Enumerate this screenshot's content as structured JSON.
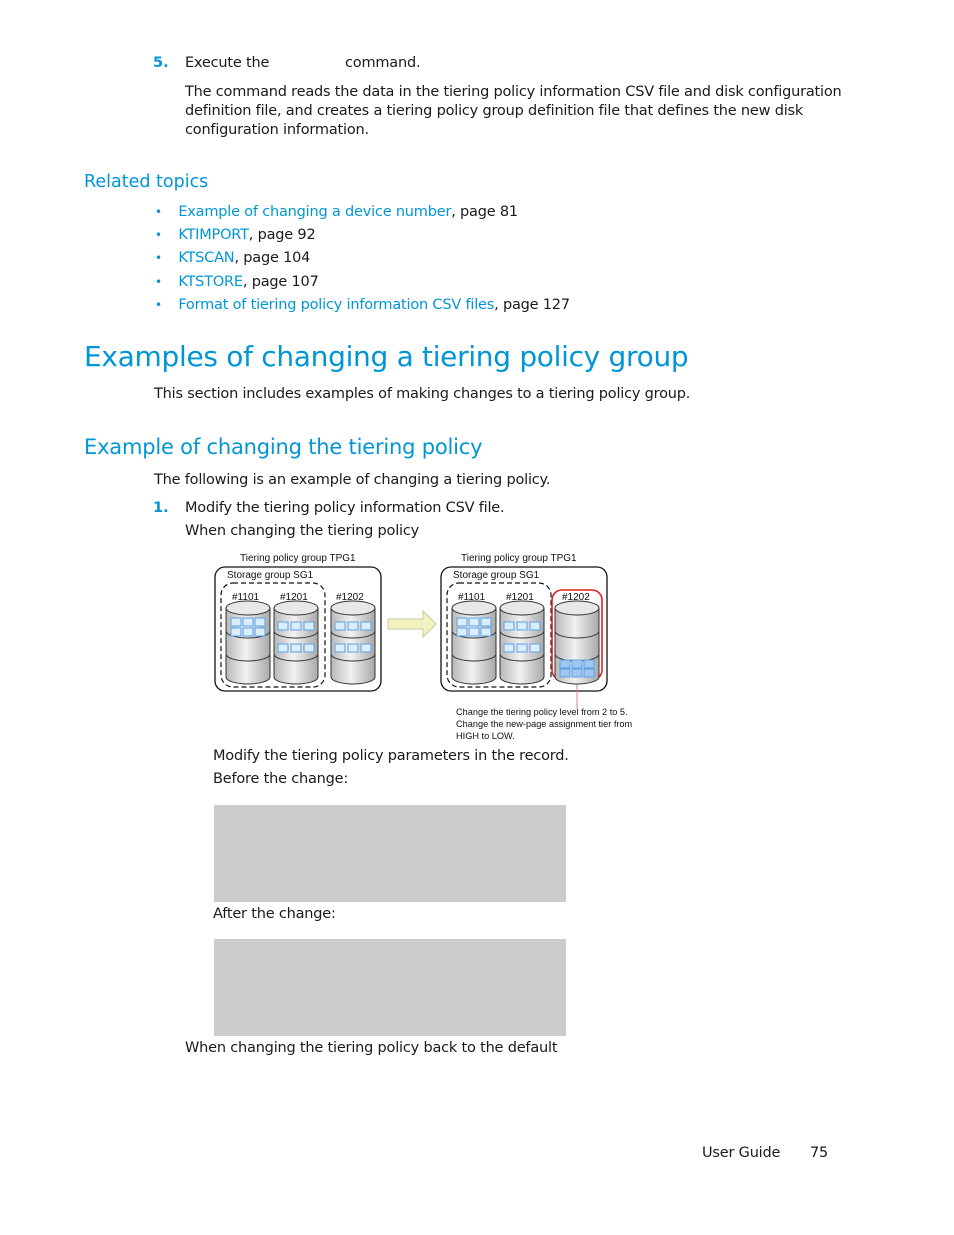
{
  "step5": {
    "number": "5.",
    "text_before": "Execute the",
    "text_after": "command.",
    "description_lines": [
      "The command reads the data in the tiering policy information CSV file and disk configuration",
      "definition file, and creates a tiering policy group definition file that defines the new disk",
      "configuration information."
    ]
  },
  "related_topics": {
    "heading": "Related topics",
    "items": [
      {
        "link": "Example of changing a device number",
        "suffix": ", page 81"
      },
      {
        "link": "KTIMPORT",
        "suffix": ", page 92"
      },
      {
        "link": "KTSCAN",
        "suffix": ", page 104"
      },
      {
        "link": "KTSTORE",
        "suffix": ", page 107"
      },
      {
        "link": "Format of tiering policy information CSV files",
        "suffix": ", page 127"
      }
    ]
  },
  "section": {
    "title": "Examples of changing a tiering policy group",
    "intro": "This section includes examples of making changes to a tiering policy group."
  },
  "subsection": {
    "title": "Example of changing the tiering policy",
    "intro": "The following is an example of changing a tiering policy.",
    "step1_number": "1.",
    "step1_text": "Modify the tiering policy information CSV file.",
    "case1_label": "When changing the tiering policy",
    "modify_text": "Modify the tiering policy parameters in the record.",
    "before_label": "Before the change:",
    "after_label": "After the change:",
    "case2_label": "When changing the tiering policy back to the default"
  },
  "diagram": {
    "before": {
      "group_label": "Tiering policy group TPG1",
      "storage_label": "Storage group SG1",
      "volumes": [
        "#1101",
        "#1201",
        "#1202"
      ]
    },
    "after": {
      "group_label": "Tiering policy group TPG1",
      "storage_label": "Storage group SG1",
      "volumes": [
        "#1101",
        "#1201",
        "#1202"
      ]
    },
    "annotation_lines": [
      "Change the tiering policy level from 2 to 5.",
      "Change the new-page assignment tier from",
      "HIGH to LOW."
    ],
    "colors": {
      "link_blue": "#0096d6",
      "page_block_fill": "#dbeeff",
      "page_block_stroke": "#5aa0e6",
      "highlight_red": "#e02020",
      "arrow_fill": "#f2f2c0",
      "code_box_gray": "#cccccc"
    }
  },
  "footer": {
    "label": "User Guide",
    "page_number": "75"
  }
}
